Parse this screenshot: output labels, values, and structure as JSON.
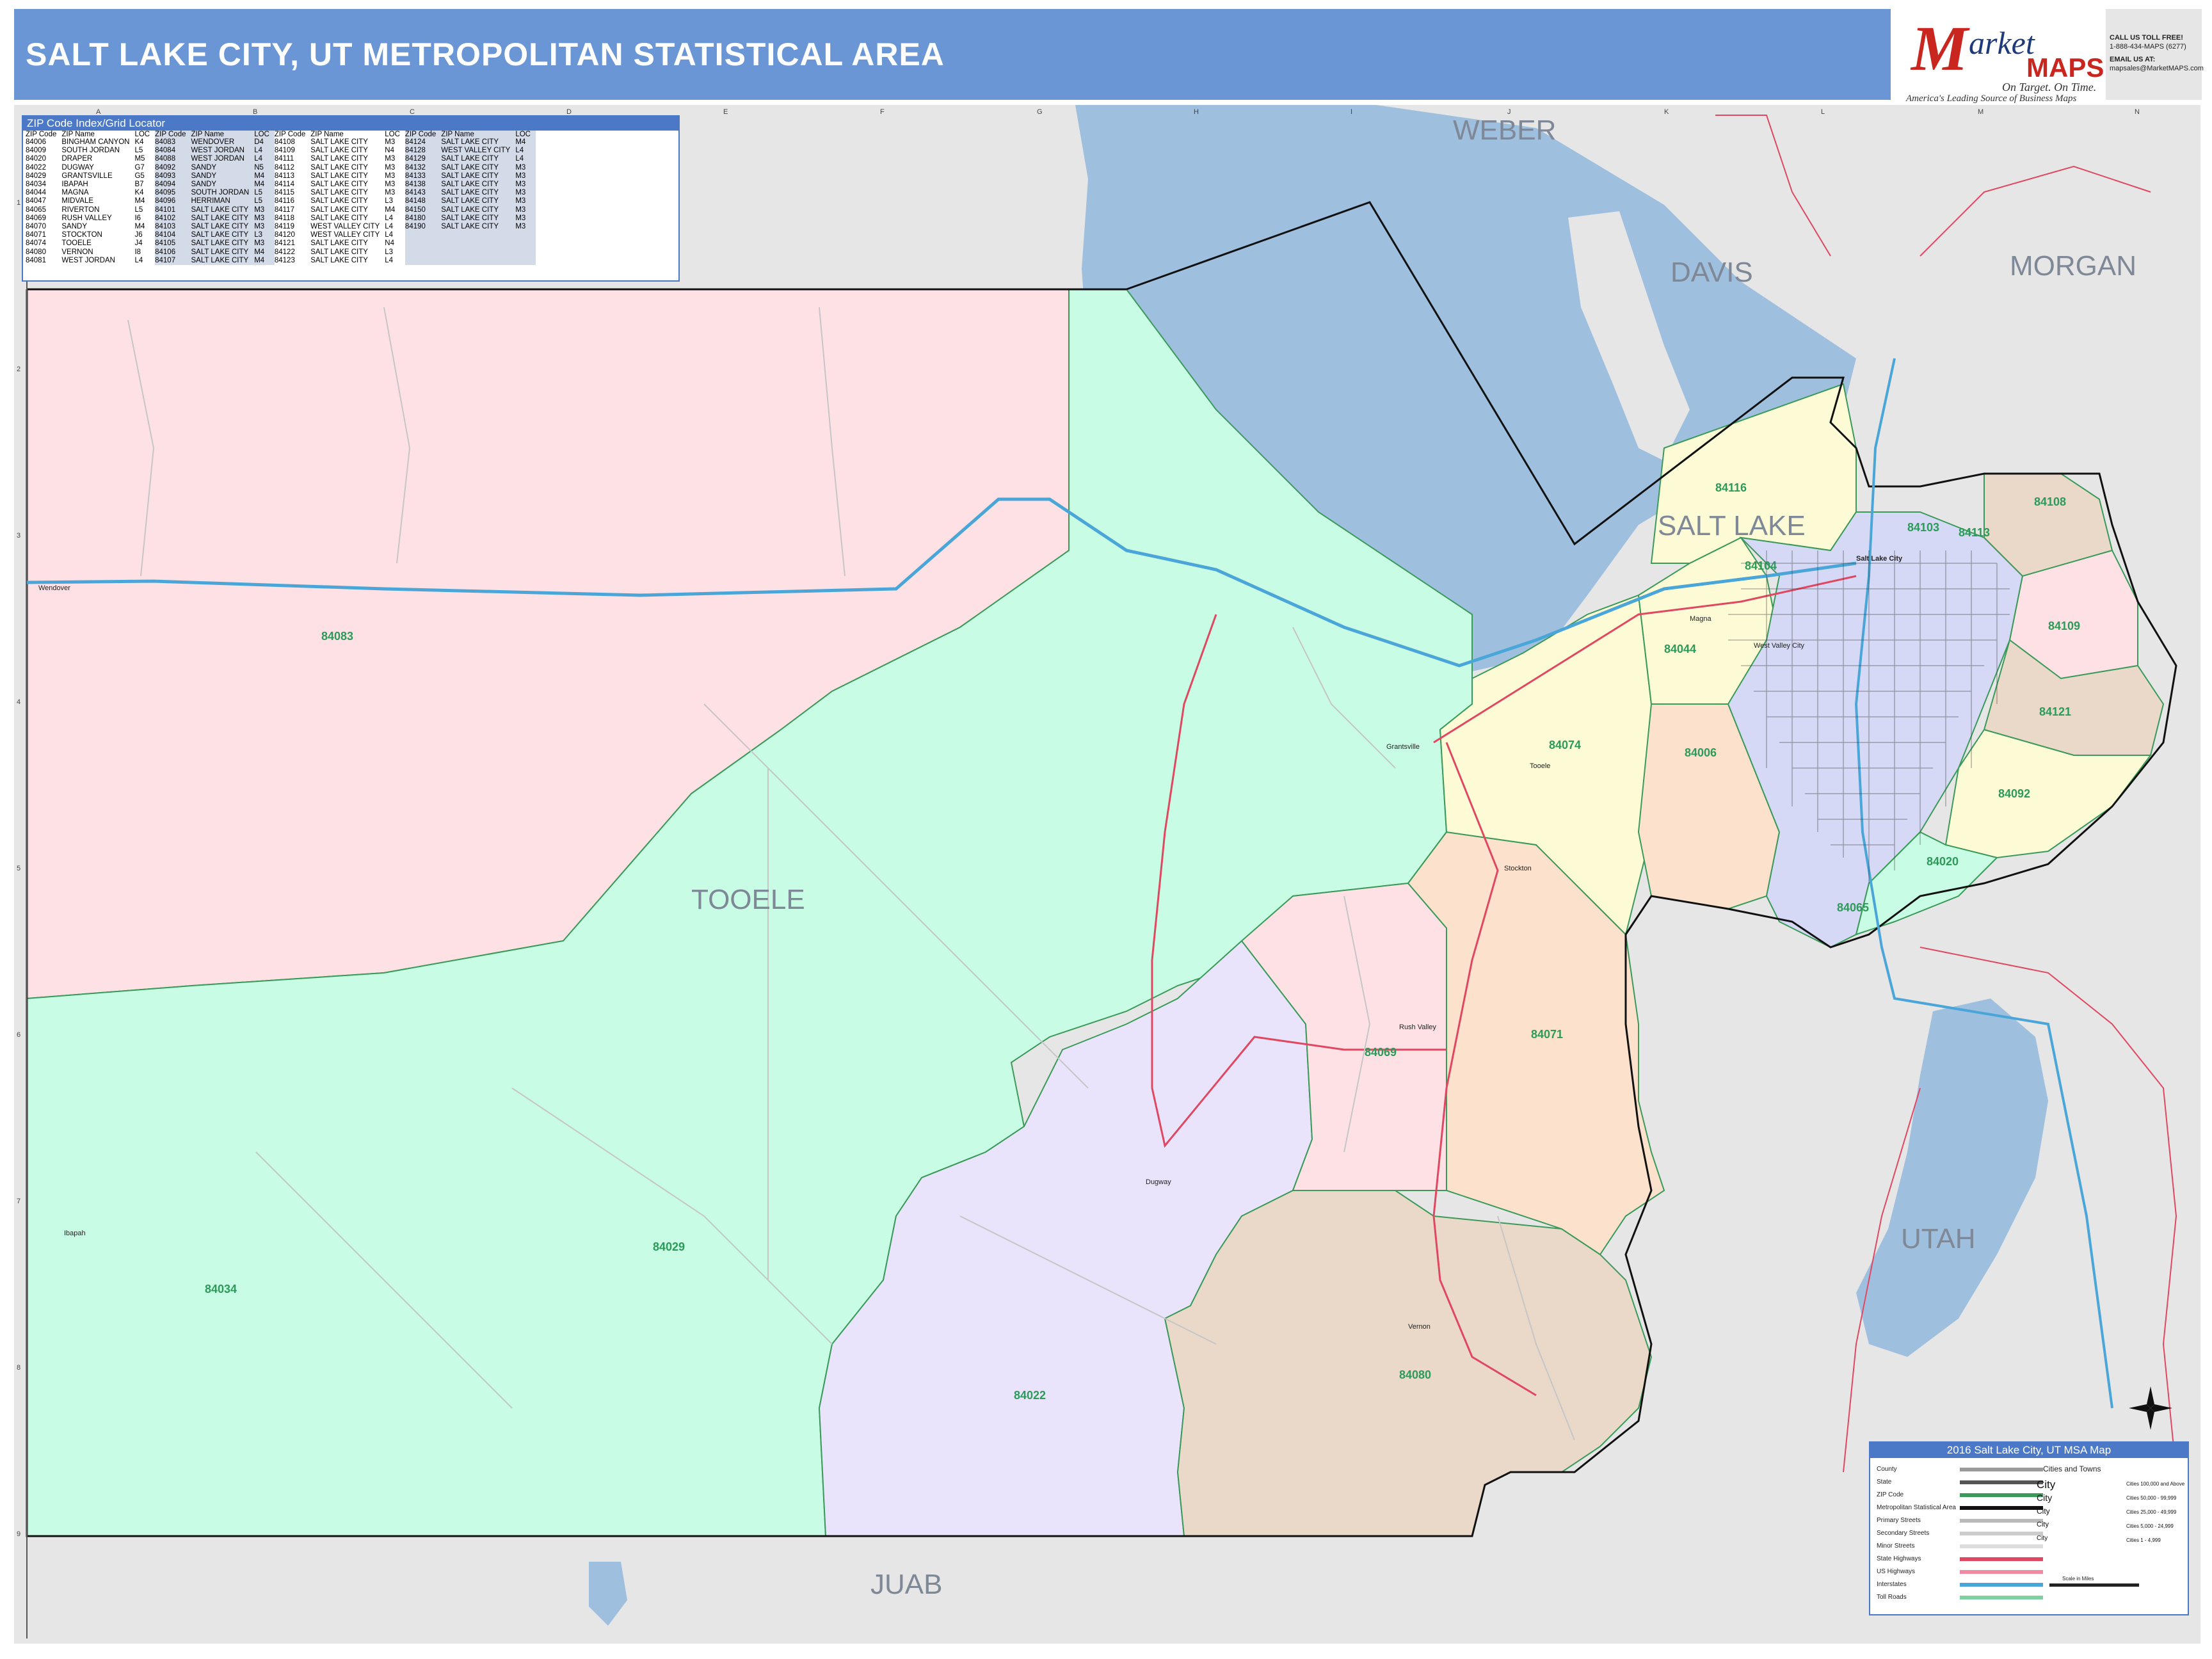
{
  "header": {
    "title": "SALT LAKE CITY, UT METROPOLITAN STATISTICAL AREA"
  },
  "brand": {
    "logo_m": "M",
    "logo_arket": "arket",
    "logo_maps": "MAPS",
    "tagline": "On Target. On Time.",
    "subline": "America's Leading Source of Business Maps",
    "call_label": "CALL US TOLL FREE!",
    "phone": "1-888-434-MAPS (6277)",
    "email_label": "EMAIL US AT:",
    "email": "mapsales@MarketMAPS.com"
  },
  "zip_index": {
    "title": "ZIP Code Index/Grid Locator",
    "headers": [
      "ZIP Code",
      "ZIP Name",
      "LOC"
    ],
    "columns": [
      [
        [
          "84006",
          "BINGHAM CANYON",
          "K4"
        ],
        [
          "84009",
          "SOUTH JORDAN",
          "L5"
        ],
        [
          "84020",
          "DRAPER",
          "M5"
        ],
        [
          "84022",
          "DUGWAY",
          "G7"
        ],
        [
          "84029",
          "GRANTSVILLE",
          "G5"
        ],
        [
          "84034",
          "IBAPAH",
          "B7"
        ],
        [
          "84044",
          "MAGNA",
          "K4"
        ],
        [
          "84047",
          "MIDVALE",
          "M4"
        ],
        [
          "84065",
          "RIVERTON",
          "L5"
        ],
        [
          "84069",
          "RUSH VALLEY",
          "I6"
        ],
        [
          "84070",
          "SANDY",
          "M4"
        ],
        [
          "84071",
          "STOCKTON",
          "J6"
        ],
        [
          "84074",
          "TOOELE",
          "J4"
        ],
        [
          "84080",
          "VERNON",
          "I8"
        ],
        [
          "84081",
          "WEST JORDAN",
          "L4"
        ]
      ],
      [
        [
          "84083",
          "WENDOVER",
          "D4"
        ],
        [
          "84084",
          "WEST JORDAN",
          "L4"
        ],
        [
          "84088",
          "WEST JORDAN",
          "L4"
        ],
        [
          "84092",
          "SANDY",
          "N5"
        ],
        [
          "84093",
          "SANDY",
          "M4"
        ],
        [
          "84094",
          "SANDY",
          "M4"
        ],
        [
          "84095",
          "SOUTH JORDAN",
          "L5"
        ],
        [
          "84096",
          "HERRIMAN",
          "L5"
        ],
        [
          "84101",
          "SALT LAKE CITY",
          "M3"
        ],
        [
          "84102",
          "SALT LAKE CITY",
          "M3"
        ],
        [
          "84103",
          "SALT LAKE CITY",
          "M3"
        ],
        [
          "84104",
          "SALT LAKE CITY",
          "L3"
        ],
        [
          "84105",
          "SALT LAKE CITY",
          "M3"
        ],
        [
          "84106",
          "SALT LAKE CITY",
          "M4"
        ],
        [
          "84107",
          "SALT LAKE CITY",
          "M4"
        ]
      ],
      [
        [
          "84108",
          "SALT LAKE CITY",
          "M3"
        ],
        [
          "84109",
          "SALT LAKE CITY",
          "N4"
        ],
        [
          "84111",
          "SALT LAKE CITY",
          "M3"
        ],
        [
          "84112",
          "SALT LAKE CITY",
          "M3"
        ],
        [
          "84113",
          "SALT LAKE CITY",
          "M3"
        ],
        [
          "84114",
          "SALT LAKE CITY",
          "M3"
        ],
        [
          "84115",
          "SALT LAKE CITY",
          "M3"
        ],
        [
          "84116",
          "SALT LAKE CITY",
          "L3"
        ],
        [
          "84117",
          "SALT LAKE CITY",
          "M4"
        ],
        [
          "84118",
          "SALT LAKE CITY",
          "L4"
        ],
        [
          "84119",
          "WEST VALLEY CITY",
          "L4"
        ],
        [
          "84120",
          "WEST VALLEY CITY",
          "L4"
        ],
        [
          "84121",
          "SALT LAKE CITY",
          "N4"
        ],
        [
          "84122",
          "SALT LAKE CITY",
          "L3"
        ],
        [
          "84123",
          "SALT LAKE CITY",
          "L4"
        ]
      ],
      [
        [
          "84124",
          "SALT LAKE CITY",
          "M4"
        ],
        [
          "84128",
          "WEST VALLEY CITY",
          "L4"
        ],
        [
          "84129",
          "SALT LAKE CITY",
          "L4"
        ],
        [
          "84132",
          "SALT LAKE CITY",
          "M3"
        ],
        [
          "84133",
          "SALT LAKE CITY",
          "M3"
        ],
        [
          "84138",
          "SALT LAKE CITY",
          "M3"
        ],
        [
          "84143",
          "SALT LAKE CITY",
          "M3"
        ],
        [
          "84148",
          "SALT LAKE CITY",
          "M3"
        ],
        [
          "84150",
          "SALT LAKE CITY",
          "M3"
        ],
        [
          "84180",
          "SALT LAKE CITY",
          "M3"
        ],
        [
          "84190",
          "SALT LAKE CITY",
          "M3"
        ]
      ]
    ]
  },
  "grid": {
    "columns": [
      "A",
      "B",
      "C",
      "D",
      "E",
      "F",
      "G",
      "H",
      "I",
      "J",
      "K",
      "L",
      "M",
      "N"
    ],
    "rows": [
      "1",
      "2",
      "3",
      "4",
      "5",
      "6",
      "7",
      "8",
      "9"
    ]
  },
  "counties": {
    "weber": "WEBER",
    "davis": "DAVIS",
    "morgan": "MORGAN",
    "salt_lake": "SALT LAKE",
    "tooele": "TOOELE",
    "utah": "UTAH",
    "juab": "JUAB"
  },
  "zip_labels": {
    "z84083": "84083",
    "z84029": "84029",
    "z84034": "84034",
    "z84022": "84022",
    "z84080": "84080",
    "z84069": "84069",
    "z84071": "84071",
    "z84074": "84074",
    "z84044": "84044",
    "z84006": "84006",
    "z84116": "84116",
    "z84104": "84104",
    "z84103": "84103",
    "z84113": "84113",
    "z84108": "84108",
    "z84109": "84109",
    "z84121": "84121",
    "z84092": "84092",
    "z84020": "84020",
    "z84065": "84065"
  },
  "places": {
    "salt_lake_city": "Salt Lake City",
    "west_valley_city": "West Valley City",
    "wendover": "Wendover",
    "grantsville": "Grantsville",
    "tooele": "Tooele",
    "stockton": "Stockton",
    "rush_valley": "Rush Valley",
    "vernon": "Vernon",
    "dugway": "Dugway",
    "ibapah": "Ibapah",
    "magna": "Magna"
  },
  "legend": {
    "title": "2016 Salt Lake City, UT MSA Map",
    "rows": [
      "County",
      "State",
      "ZIP Code",
      "Metropolitan Statistical Area",
      "Primary Streets",
      "Secondary Streets",
      "Minor Streets",
      "State Highways",
      "US Highways",
      "Interstates",
      "Toll Roads"
    ],
    "cities_title": "Cities and Towns",
    "cities": [
      {
        "name": "City",
        "size": "Cities 100,000 and Above"
      },
      {
        "name": "City",
        "size": "Cities 50,000 - 99,999"
      },
      {
        "name": "City",
        "size": "Cities 25,000 - 49,999"
      },
      {
        "name": "City",
        "size": "Cities 5,000 - 24,999"
      },
      {
        "name": "City",
        "size": "Cities 1 - 4,999"
      }
    ],
    "scale": "Scale in Miles"
  },
  "colors": {
    "header": "#6b96d6",
    "lake": "#9fbfdf",
    "zip_84083": "#fde1e4",
    "zip_84029": "#c9fce4",
    "zip_84022": "#e9e4fc",
    "zip_84080": "#ead9c8",
    "zip_84069": "#fde1e4",
    "zip_84071": "#fce2cc",
    "zip_84074": "#fdfbd6",
    "outside": "#e6e6e6",
    "highway": "#e04862",
    "interstate": "#4aa6d8",
    "zip_border": "#3a9a5a"
  }
}
